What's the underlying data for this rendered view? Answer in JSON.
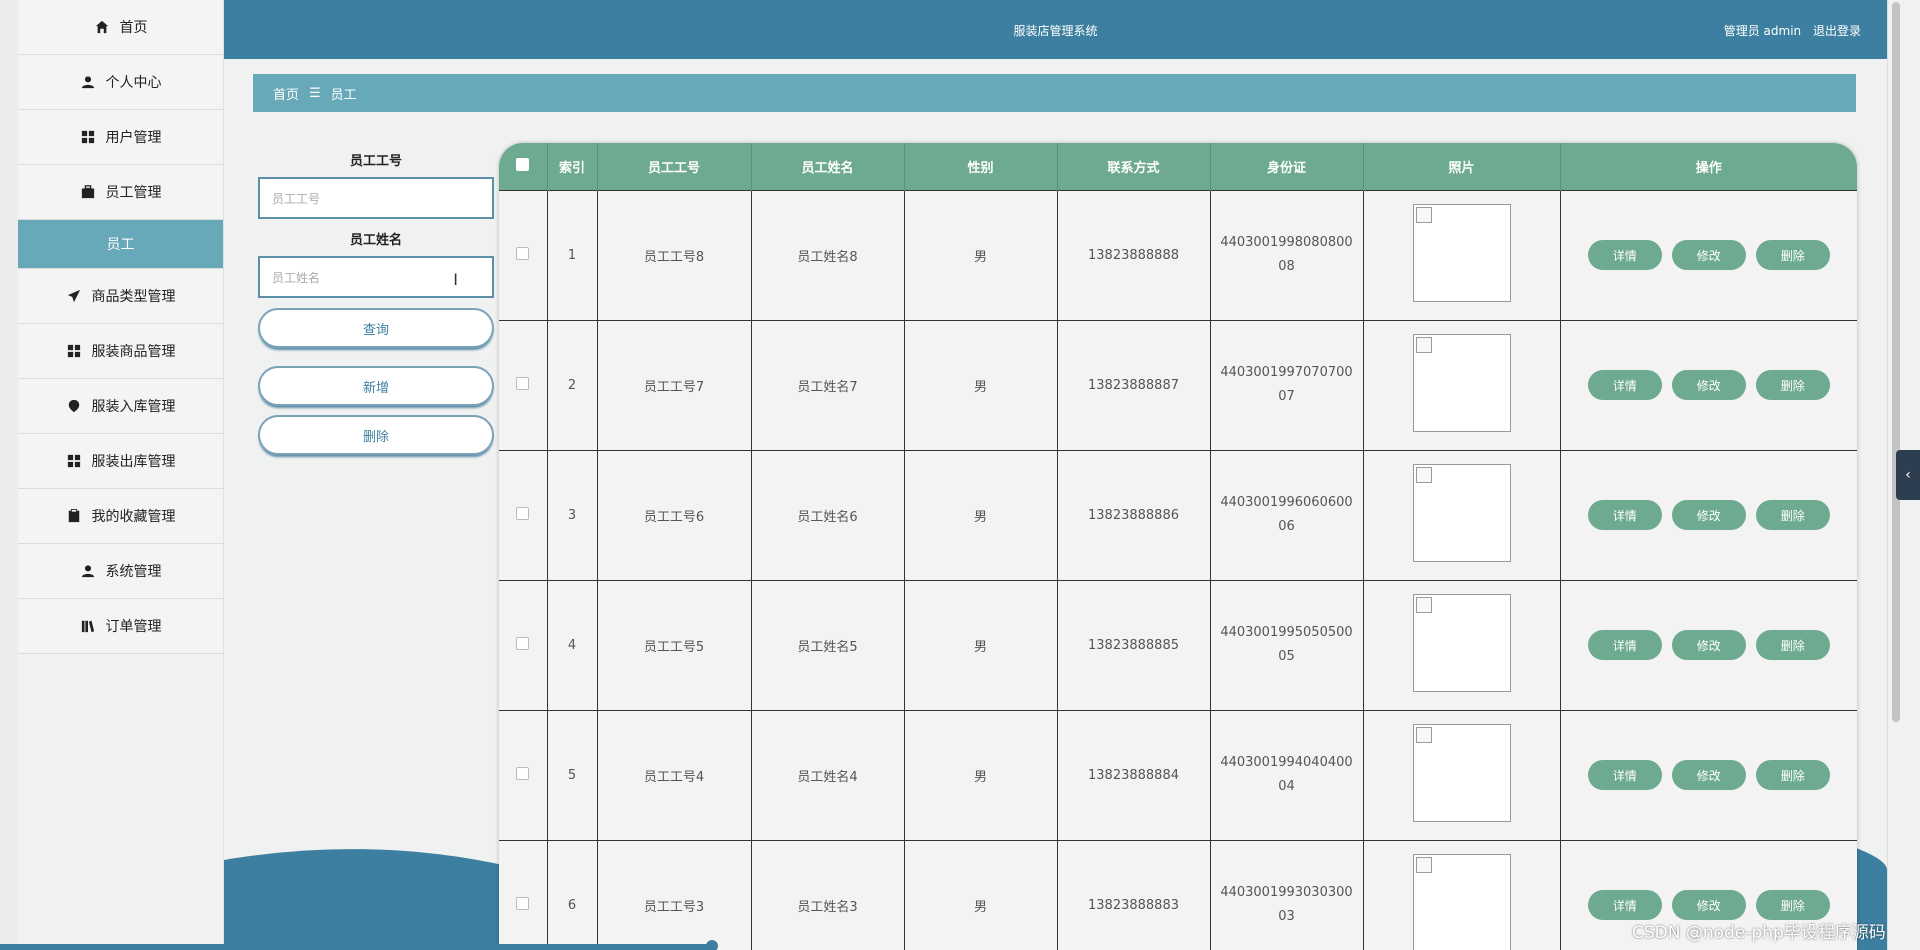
{
  "app_title": "服装店管理系统",
  "header": {
    "user": "管理员 admin",
    "logout": "退出登录"
  },
  "breadcrumb": {
    "home": "首页",
    "separator": "☰",
    "current": "员工"
  },
  "sidebar": {
    "items": [
      {
        "label": "首页",
        "icon": "home-icon"
      },
      {
        "label": "个人中心",
        "icon": "user-icon"
      },
      {
        "label": "用户管理",
        "icon": "grid-icon"
      },
      {
        "label": "员工管理",
        "icon": "briefcase-icon"
      },
      {
        "label": "员工",
        "icon": "",
        "sub": true,
        "active": true
      },
      {
        "label": "商品类型管理",
        "icon": "send-icon"
      },
      {
        "label": "服装商品管理",
        "icon": "grid-icon"
      },
      {
        "label": "服装入库管理",
        "icon": "pin-icon"
      },
      {
        "label": "服装出库管理",
        "icon": "grid-icon"
      },
      {
        "label": "我的收藏管理",
        "icon": "clipboard-icon"
      },
      {
        "label": "系统管理",
        "icon": "user-icon"
      },
      {
        "label": "订单管理",
        "icon": "book-icon"
      }
    ]
  },
  "search": {
    "id_label": "员工工号",
    "id_placeholder": "员工工号",
    "name_label": "员工姓名",
    "name_placeholder": "员工姓名",
    "query_button": "查询",
    "add_button": "新增",
    "delete_button": "删除"
  },
  "table": {
    "headers": [
      "索引",
      "员工工号",
      "员工姓名",
      "性别",
      "联系方式",
      "身份证",
      "照片",
      "操作"
    ],
    "rows": [
      {
        "index": "1",
        "id": "员工工号8",
        "name": "员工姓名8",
        "gender": "男",
        "phone": "13823888888",
        "idcard_1": "4403001998080800",
        "idcard_2": "08"
      },
      {
        "index": "2",
        "id": "员工工号7",
        "name": "员工姓名7",
        "gender": "男",
        "phone": "13823888887",
        "idcard_1": "4403001997070700",
        "idcard_2": "07"
      },
      {
        "index": "3",
        "id": "员工工号6",
        "name": "员工姓名6",
        "gender": "男",
        "phone": "13823888886",
        "idcard_1": "4403001996060600",
        "idcard_2": "06"
      },
      {
        "index": "4",
        "id": "员工工号5",
        "name": "员工姓名5",
        "gender": "男",
        "phone": "13823888885",
        "idcard_1": "4403001995050500",
        "idcard_2": "05"
      },
      {
        "index": "5",
        "id": "员工工号4",
        "name": "员工姓名4",
        "gender": "男",
        "phone": "13823888884",
        "idcard_1": "4403001994040400",
        "idcard_2": "04"
      },
      {
        "index": "6",
        "id": "员工工号3",
        "name": "员工姓名3",
        "gender": "男",
        "phone": "13823888883",
        "idcard_1": "4403001993030300",
        "idcard_2": "03"
      }
    ],
    "op_detail": "详情",
    "op_edit": "修改",
    "op_delete": "删除"
  },
  "side_tab_glyph": "‹",
  "watermark": "CSDN @node-php毕设程序源码",
  "colors": {
    "topbar": "#3d7fa0",
    "accent": "#67a9b8",
    "table_header": "#6daa90"
  }
}
